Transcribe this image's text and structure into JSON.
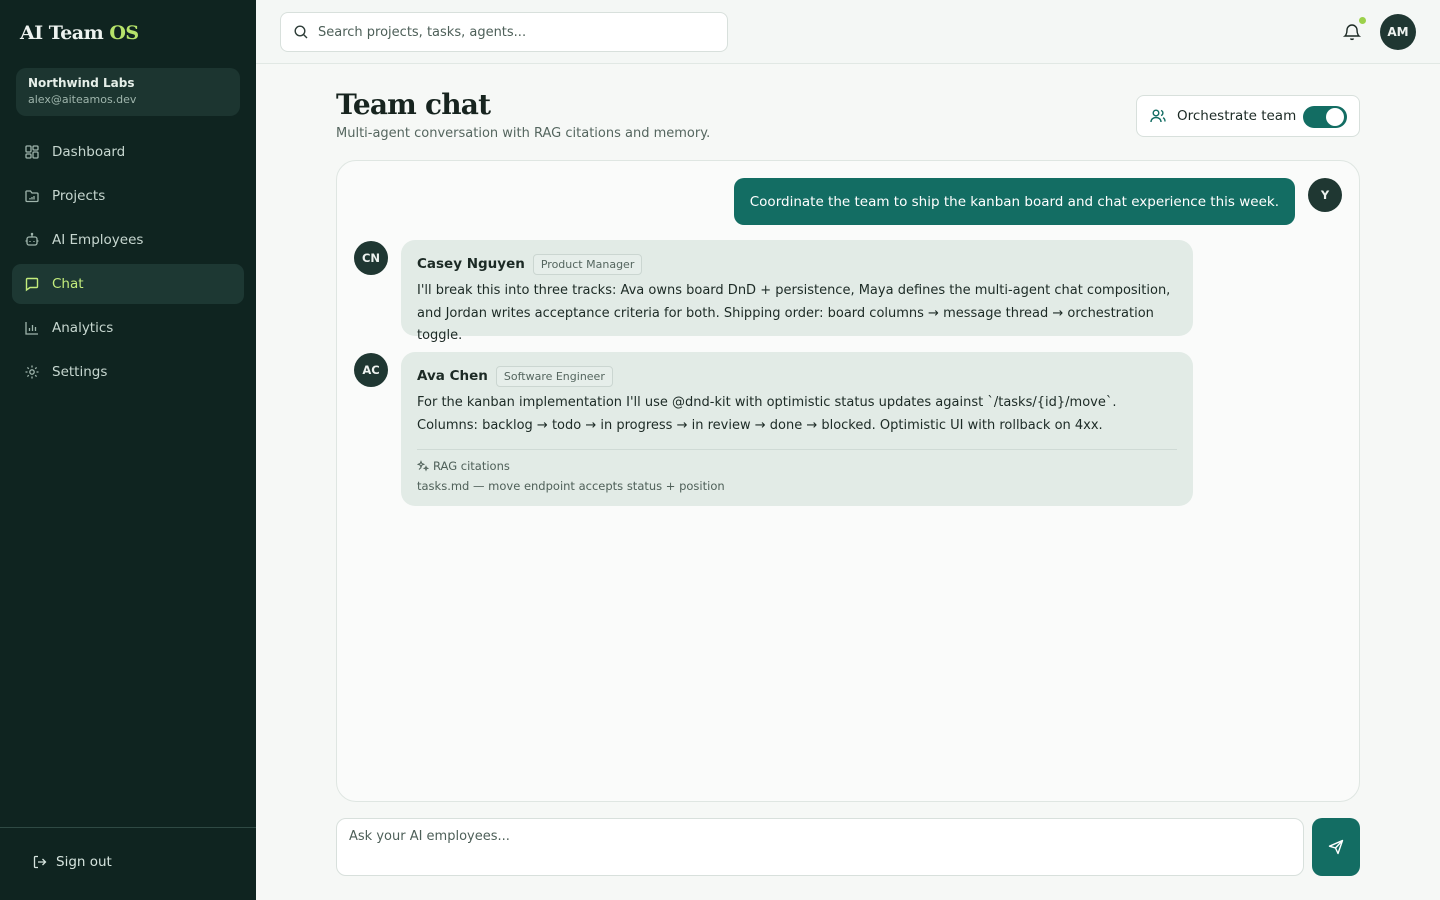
{
  "app": {
    "brand_main": "AI Team",
    "brand_accent": "OS",
    "accent_color": "#b6e36a",
    "primary_color": "#136d63"
  },
  "org": {
    "name": "Northwind Labs",
    "email": "alex@aiteamos.dev"
  },
  "sidebar": {
    "items": [
      {
        "label": "Dashboard",
        "icon": "dashboard-icon",
        "active": false
      },
      {
        "label": "Projects",
        "icon": "folder-icon",
        "active": false
      },
      {
        "label": "AI Employees",
        "icon": "bot-icon",
        "active": false
      },
      {
        "label": "Chat",
        "icon": "chat-icon",
        "active": true
      },
      {
        "label": "Analytics",
        "icon": "chart-icon",
        "active": false
      },
      {
        "label": "Settings",
        "icon": "gear-icon",
        "active": false
      }
    ],
    "signout_label": "Sign out"
  },
  "topbar": {
    "search_placeholder": "Search projects, tasks, agents...",
    "user_initials": "AM",
    "notification_unread": true
  },
  "header": {
    "title": "Team chat",
    "subtitle": "Multi-agent conversation with RAG citations and memory.",
    "orchestrate_label": "Orchestrate team",
    "orchestrate_on": true
  },
  "chat": {
    "user_message": {
      "initials": "Y",
      "text": "Coordinate the team to ship the kanban board and chat experience this week."
    },
    "agent_messages": [
      {
        "initials": "CN",
        "name": "Casey Nguyen",
        "role": "Product Manager",
        "text": "I'll break this into three tracks: Ava owns board DnD + persistence, Maya defines the multi-agent chat composition, and Jordan writes acceptance criteria for both. Shipping order: board columns → message thread → orchestration toggle."
      },
      {
        "initials": "AC",
        "name": "Ava Chen",
        "role": "Software Engineer",
        "text": "For the kanban implementation I'll use @dnd-kit with optimistic status updates against `/tasks/{id}/move`. Columns: backlog → todo → in progress → in review → done → blocked. Optimistic UI with rollback on 4xx.",
        "citations_label": "RAG citations",
        "citations": [
          "tasks.md — move endpoint accepts status + position"
        ]
      }
    ]
  },
  "composer": {
    "placeholder": "Ask your AI employees..."
  }
}
